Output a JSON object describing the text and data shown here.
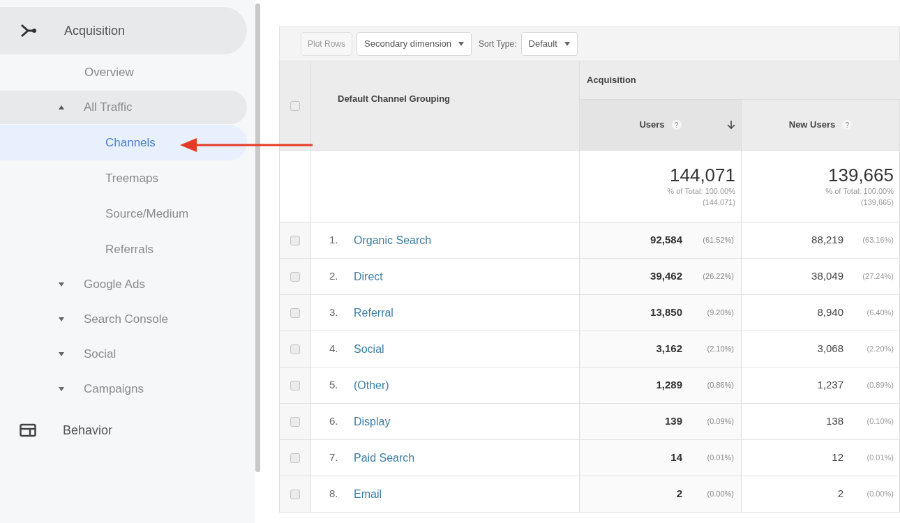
{
  "sidebar": {
    "sections": [
      {
        "label": "Acquisition",
        "expanded": true,
        "children": [
          {
            "label": "Overview",
            "selected": false
          },
          {
            "label": "All Traffic",
            "expanded": true,
            "children": [
              {
                "label": "Channels",
                "selected": true
              },
              {
                "label": "Treemaps",
                "selected": false
              },
              {
                "label": "Source/Medium",
                "selected": false
              },
              {
                "label": "Referrals",
                "selected": false
              }
            ]
          },
          {
            "label": "Google Ads",
            "expanded": false
          },
          {
            "label": "Search Console",
            "expanded": false
          },
          {
            "label": "Social",
            "expanded": false
          },
          {
            "label": "Campaigns",
            "expanded": false
          }
        ]
      },
      {
        "label": "Behavior",
        "expanded": false
      }
    ]
  },
  "toolbar": {
    "plot_rows": {
      "label": "Plot Rows",
      "disabled": true
    },
    "secondary_dimension": "Secondary dimension",
    "sort_type_label": "Sort Type:",
    "sort_type": "Default"
  },
  "table": {
    "select_all_checked": false,
    "dimension_header": "Default Channel Grouping",
    "group_header": "Acquisition",
    "columns": [
      {
        "label": "Users",
        "help": "?",
        "sorted": true
      },
      {
        "label": "New Users",
        "help": "?",
        "sorted": false
      }
    ],
    "totals": [
      {
        "value": "144,071",
        "share": "% of Total: 100.00%",
        "total": "(144,071)"
      },
      {
        "value": "139,665",
        "share": "% of Total: 100.00%",
        "total": "(139,665)"
      }
    ],
    "rows": [
      {
        "checked": false,
        "index": "1.",
        "channel": "Organic Search",
        "users": "92,584",
        "users_pct": "(61.52%)",
        "new_users": "88,219",
        "new_users_pct": "(63.16%)"
      },
      {
        "checked": false,
        "index": "2.",
        "channel": "Direct",
        "users": "39,462",
        "users_pct": "(26.22%)",
        "new_users": "38,049",
        "new_users_pct": "(27.24%)"
      },
      {
        "checked": false,
        "index": "3.",
        "channel": "Referral",
        "users": "13,850",
        "users_pct": "(9.20%)",
        "new_users": "8,940",
        "new_users_pct": "(6.40%)"
      },
      {
        "checked": false,
        "index": "4.",
        "channel": "Social",
        "users": "3,162",
        "users_pct": "(2.10%)",
        "new_users": "3,068",
        "new_users_pct": "(2.20%)"
      },
      {
        "checked": false,
        "index": "5.",
        "channel": "(Other)",
        "users": "1,289",
        "users_pct": "(0.86%)",
        "new_users": "1,237",
        "new_users_pct": "(0.89%)"
      },
      {
        "checked": false,
        "index": "6.",
        "channel": "Display",
        "users": "139",
        "users_pct": "(0.09%)",
        "new_users": "138",
        "new_users_pct": "(0.10%)"
      },
      {
        "checked": false,
        "index": "7.",
        "channel": "Paid Search",
        "users": "14",
        "users_pct": "(0.01%)",
        "new_users": "12",
        "new_users_pct": "(0.01%)"
      },
      {
        "checked": false,
        "index": "8.",
        "channel": "Email",
        "users": "2",
        "users_pct": "(0.00%)",
        "new_users": "2",
        "new_users_pct": "(0.00%)"
      }
    ]
  }
}
